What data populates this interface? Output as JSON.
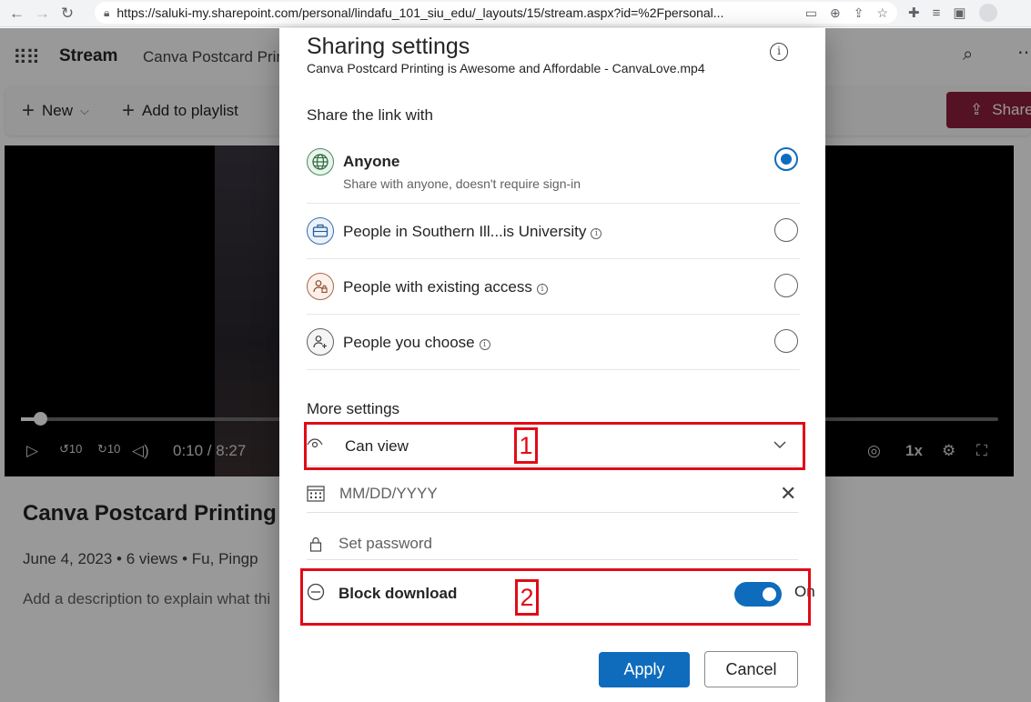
{
  "browser": {
    "url": "https://saluki-my.sharepoint.com/personal/lindafu_101_siu_edu/_layouts/15/stream.aspx?id=%2Fpersonal..."
  },
  "app": {
    "brand": "Stream",
    "breadcrumb": "Canva Postcard Prin",
    "toolbar": {
      "new_label": "New",
      "add_to_playlist_label": "Add to playlist",
      "share_label": "Share"
    },
    "player": {
      "time": "0:10 / 8:27",
      "speed": "1x",
      "rewind_label": "10",
      "forward_label": "10",
      "progress_fraction": 0.02
    },
    "video_title": "Canva Postcard Printing i",
    "meta": "June 4, 2023  •  6 views  •  Fu, Pingp",
    "description": "Add a description to explain what thi"
  },
  "dialog": {
    "title": "Sharing settings",
    "subtitle": "Canva Postcard Printing is Awesome and Affordable - CanvaLove.mp4",
    "share_heading": "Share the link with",
    "options": [
      {
        "label": "Anyone",
        "desc": "Share with anyone, doesn't require sign-in",
        "selected": true
      },
      {
        "label": "People in Southern Ill...is University",
        "selected": false
      },
      {
        "label": "People with existing access",
        "selected": false
      },
      {
        "label": "People you choose",
        "selected": false
      }
    ],
    "more_heading": "More settings",
    "permission": "Can view",
    "date_placeholder": "MM/DD/YYYY",
    "password_placeholder": "Set password",
    "block_download_label": "Block download",
    "block_download_state": "On",
    "apply_label": "Apply",
    "cancel_label": "Cancel",
    "annotations": [
      "1",
      "2"
    ]
  },
  "colors": {
    "accent": "#0f6cbd",
    "share_button": "#8d1e3d",
    "annotation": "#e10b17"
  }
}
